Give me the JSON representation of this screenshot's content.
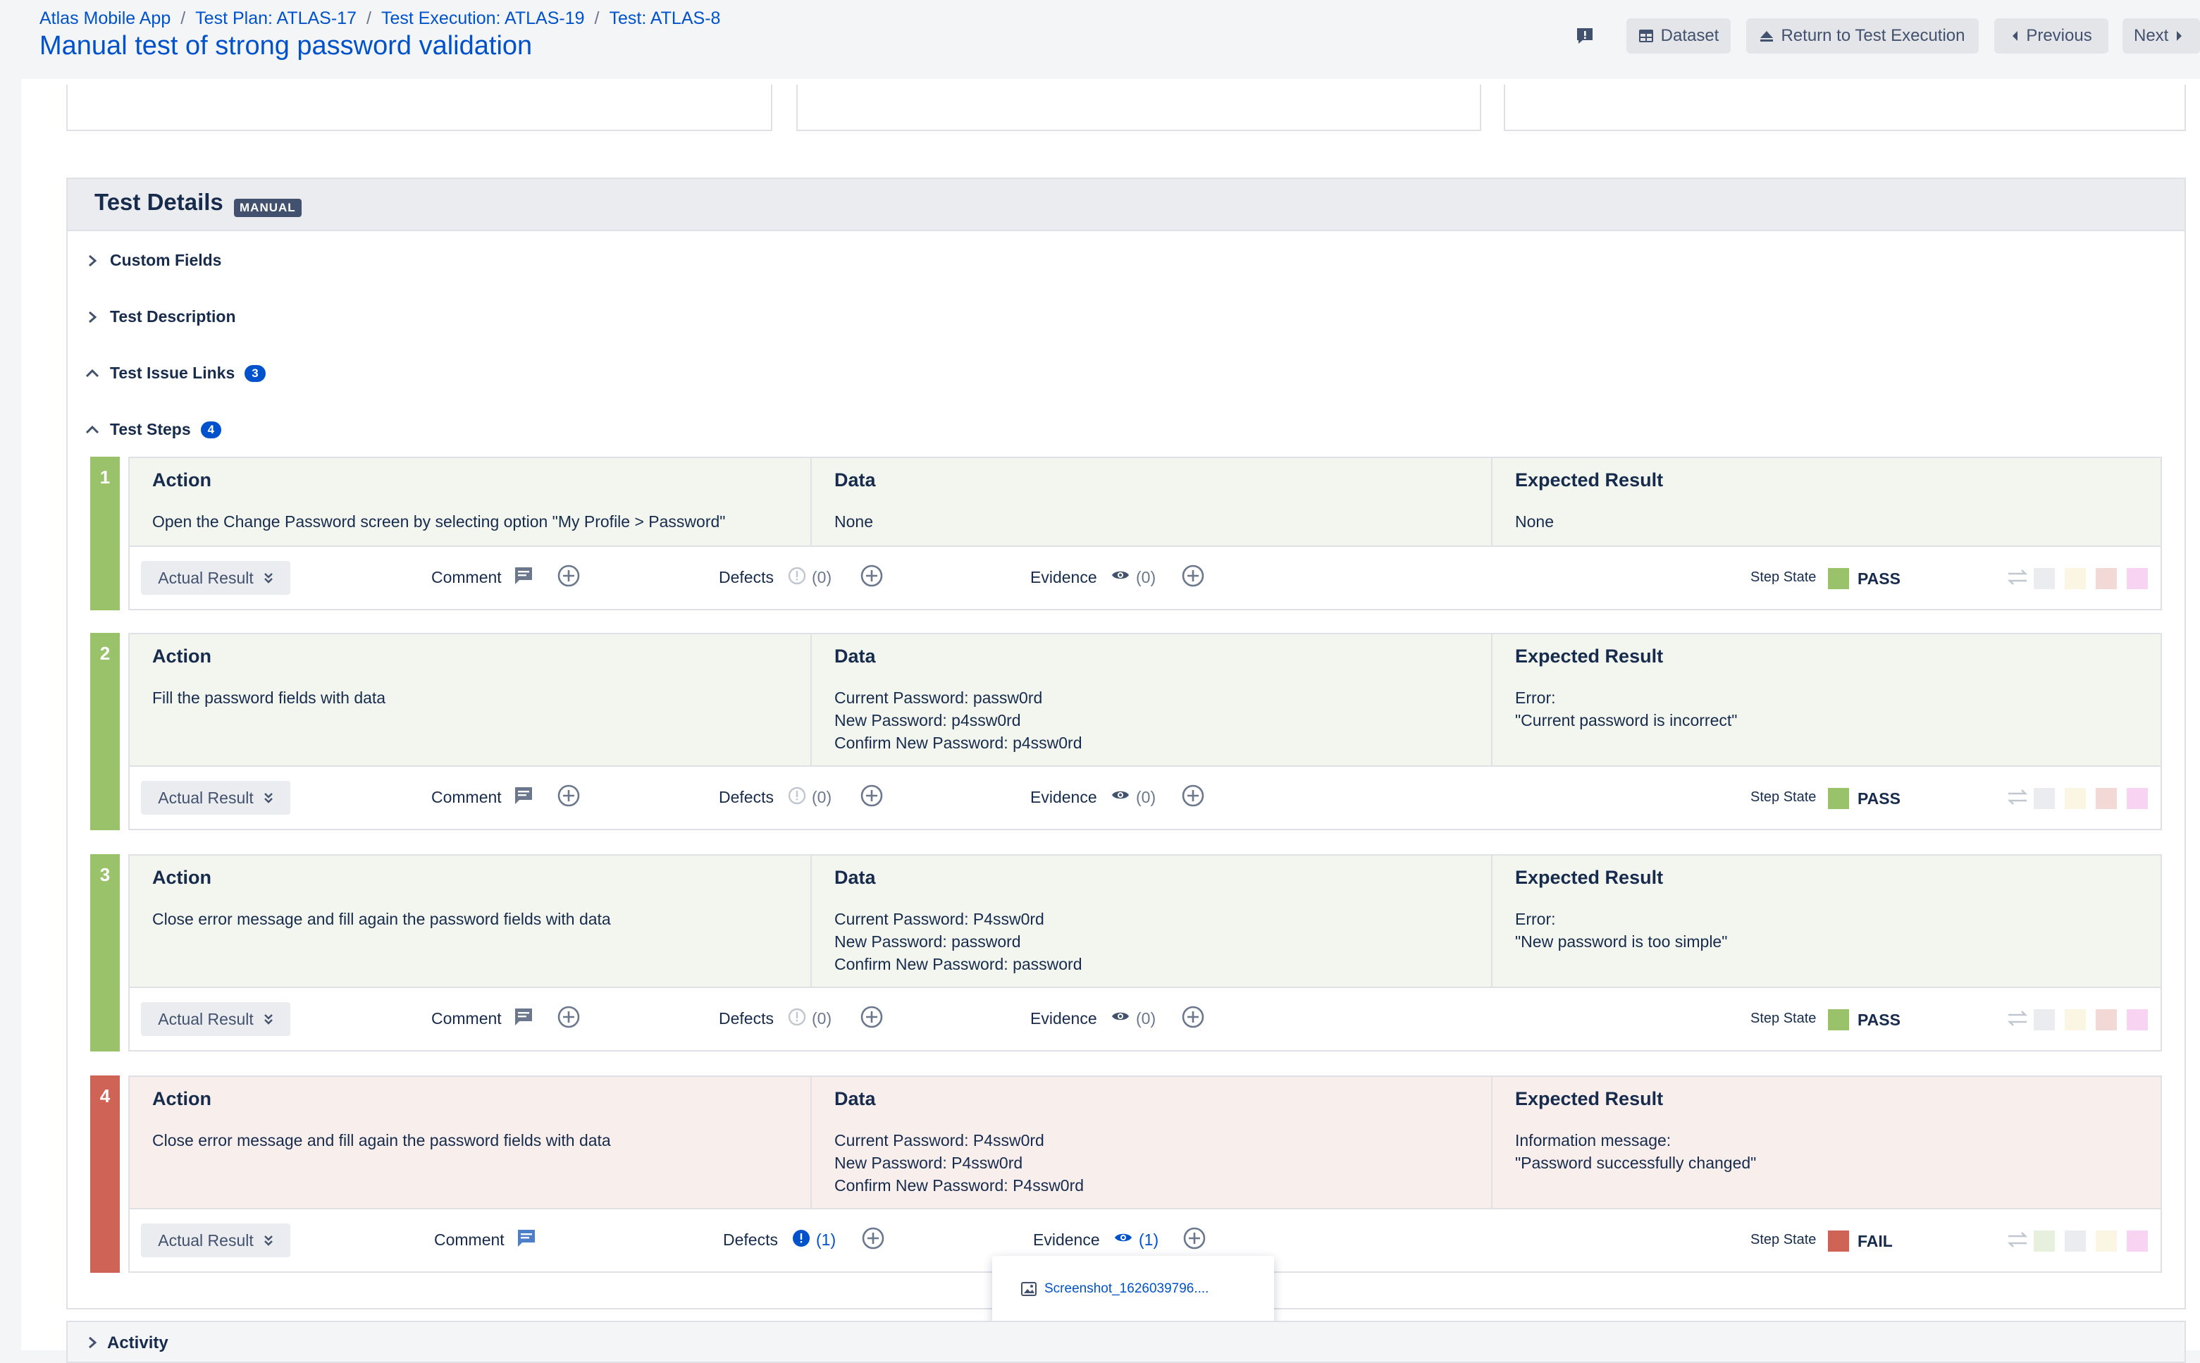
{
  "breadcrumb": [
    {
      "label": "Atlas Mobile App"
    },
    {
      "label": "Test Plan: ATLAS-17"
    },
    {
      "label": "Test Execution: ATLAS-19"
    },
    {
      "label": "Test: ATLAS-8"
    }
  ],
  "page_title": "Manual test of strong password validation",
  "header_buttons": {
    "dataset": "Dataset",
    "return": "Return to Test Execution",
    "previous": "Previous",
    "next": "Next"
  },
  "details": {
    "title": "Test Details",
    "badge": "MANUAL",
    "sections": {
      "custom_fields": "Custom Fields",
      "description": "Test Description",
      "issue_links": "Test Issue Links",
      "issue_links_count": "3",
      "steps": "Test Steps",
      "steps_count": "4"
    }
  },
  "columns": {
    "action": "Action",
    "data": "Data",
    "expected": "Expected Result"
  },
  "step_labels": {
    "actual_result": "Actual Result",
    "comment": "Comment",
    "defects": "Defects",
    "evidence": "Evidence",
    "step_state": "Step State"
  },
  "steps": [
    {
      "number": "1",
      "action": "Open the Change Password screen by selecting option \"My Profile > Password\"",
      "data": "None",
      "expected": "None",
      "defects_count": "(0)",
      "evidence_count": "(0)",
      "state": "PASS"
    },
    {
      "number": "2",
      "action": "Fill the password fields with data",
      "data": "Current Password: passw0rd\nNew Password: p4ssw0rd\nConfirm New Password: p4ssw0rd",
      "expected": "Error:\n\"Current password is incorrect\"",
      "defects_count": "(0)",
      "evidence_count": "(0)",
      "state": "PASS"
    },
    {
      "number": "3",
      "action": "Close error message and fill again the password fields with data",
      "data": "Current Password: P4ssw0rd\nNew Password: password\nConfirm New Password: password",
      "expected": "Error:\n\"New password is too simple\"",
      "defects_count": "(0)",
      "evidence_count": "(0)",
      "state": "PASS"
    },
    {
      "number": "4",
      "action": "Close error message and fill again the password fields with data",
      "data": "Current Password: P4ssw0rd\nNew Password: P4ssw0rd\nConfirm New Password: P4ssw0rd",
      "expected": "Information message:\n\"Password successfully changed\"",
      "defects_count": "(1)",
      "evidence_count": "(1)",
      "state": "FAIL"
    }
  ],
  "evidence_popup": {
    "file": "Screenshot_1626039796...."
  },
  "activity": "Activity",
  "colors": {
    "pass": "#99c26b",
    "fail": "#cf6456",
    "pass_bg": "#f3f6ef",
    "fail_bg": "#f8efed",
    "link": "#0052cc"
  }
}
